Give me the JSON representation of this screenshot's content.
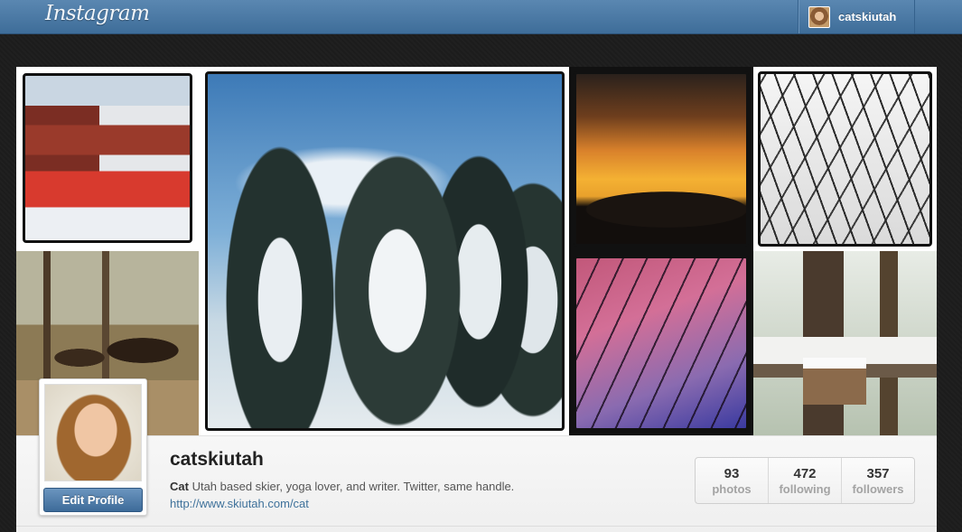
{
  "header": {
    "logo_text": "Instagram",
    "username": "catskiutah"
  },
  "photos": [
    {
      "name": "photo-ski-lodge"
    },
    {
      "name": "photo-moose-forest"
    },
    {
      "name": "photo-snowy-trees"
    },
    {
      "name": "photo-sunset"
    },
    {
      "name": "photo-snowy-branches"
    },
    {
      "name": "photo-pink-sky"
    },
    {
      "name": "photo-birdhouse"
    }
  ],
  "profile": {
    "username": "catskiutah",
    "bio_name": "Cat",
    "bio_text": " Utah based skier, yoga lover, and writer. Twitter, same handle.",
    "website": "http://www.skiutah.com/cat",
    "edit_button": "Edit Profile"
  },
  "stats": {
    "photos": {
      "count": "93",
      "label": "photos"
    },
    "following": {
      "count": "472",
      "label": "following"
    },
    "followers": {
      "count": "357",
      "label": "followers"
    }
  },
  "colors": {
    "header_blue": "#4a7aa8",
    "link_blue": "#3f729b",
    "button_blue": "#4e7eaf"
  }
}
